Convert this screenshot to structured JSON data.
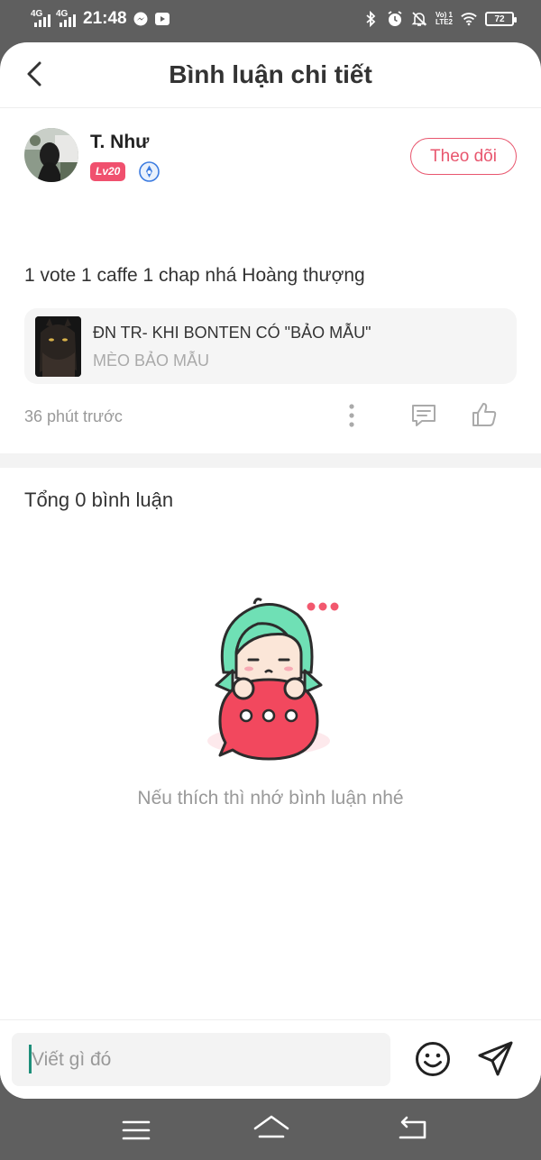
{
  "status_bar": {
    "network1": "4G",
    "network2": "4G",
    "time": "21:48",
    "volte_line1": "Vo) 1",
    "volte_line2": "LTE2",
    "battery": "72",
    "icons": [
      "messenger-icon",
      "youtube-icon",
      "bluetooth-icon",
      "alarm-icon",
      "mute-icon",
      "wifi-icon"
    ]
  },
  "header": {
    "title": "Bình luận chi tiết"
  },
  "post": {
    "username": "T. Như",
    "level": "Lv20",
    "follow_label": "Theo dõi",
    "text": "1 vote 1 caffe 1 chap nhá Hoàng thượng",
    "story": {
      "title": "ĐN TR- KHI BONTEN CÓ \"BẢO MẪU\"",
      "author": "MÈO BẢO MẪU"
    },
    "time": "36 phút trước"
  },
  "comments": {
    "total": "Tổng 0 bình luận",
    "empty_text": "Nếu thích thì nhớ bình luận nhé"
  },
  "input": {
    "placeholder": "Viết gì đó"
  },
  "colors": {
    "accent": "#e8566e",
    "badge": "#f0506e",
    "mascot_hair": "#6fe0b5",
    "mascot_bubble": "#f2485e"
  }
}
